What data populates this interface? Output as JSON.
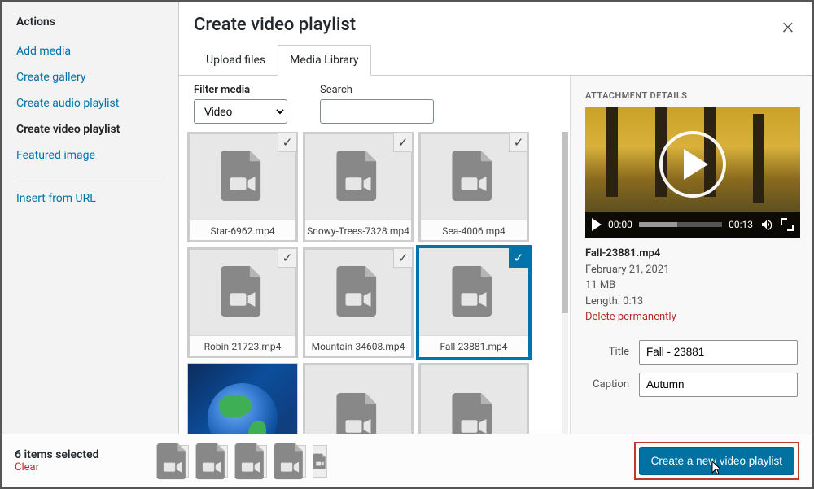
{
  "sidebar": {
    "heading": "Actions",
    "items": [
      {
        "label": "Add media",
        "active": false
      },
      {
        "label": "Create gallery",
        "active": false
      },
      {
        "label": "Create audio playlist",
        "active": false
      },
      {
        "label": "Create video playlist",
        "active": true
      },
      {
        "label": "Featured image",
        "active": false
      }
    ],
    "insert_label": "Insert from URL"
  },
  "title": "Create video playlist",
  "tabs": {
    "upload": "Upload files",
    "library": "Media Library"
  },
  "filter": {
    "filter_label": "Filter media",
    "filter_value": "Video",
    "search_label": "Search",
    "search_value": ""
  },
  "grid": {
    "items": [
      {
        "label": "Star-6962.mp4",
        "checked": true,
        "current": false,
        "kind": "video"
      },
      {
        "label": "Snowy-Trees-7328.mp4",
        "checked": true,
        "current": false,
        "kind": "video"
      },
      {
        "label": "Sea-4006.mp4",
        "checked": true,
        "current": false,
        "kind": "video"
      },
      {
        "label": "Robin-21723.mp4",
        "checked": true,
        "current": false,
        "kind": "video"
      },
      {
        "label": "Mountain-34608.mp4",
        "checked": true,
        "current": false,
        "kind": "video"
      },
      {
        "label": "Fall-23881.mp4",
        "checked": true,
        "current": true,
        "kind": "video"
      },
      {
        "label": "",
        "checked": false,
        "current": false,
        "kind": "image"
      },
      {
        "label": "",
        "checked": false,
        "current": false,
        "kind": "video-nolabel"
      },
      {
        "label": "",
        "checked": false,
        "current": false,
        "kind": "video-nolabel"
      }
    ]
  },
  "detail": {
    "heading": "ATTACHMENT DETAILS",
    "playbar": {
      "current": "00:00",
      "duration": "00:13"
    },
    "filename": "Fall-23881.mp4",
    "date": "February 21, 2021",
    "size": "11 MB",
    "length_label": "Length: 0:13",
    "delete_label": "Delete permanently",
    "fields": {
      "title_label": "Title",
      "title_value": "Fall - 23881",
      "caption_label": "Caption",
      "caption_value": "Autumn"
    }
  },
  "footer": {
    "count_label": "6 items selected",
    "clear_label": "Clear",
    "primary_label": "Create a new video playlist"
  }
}
